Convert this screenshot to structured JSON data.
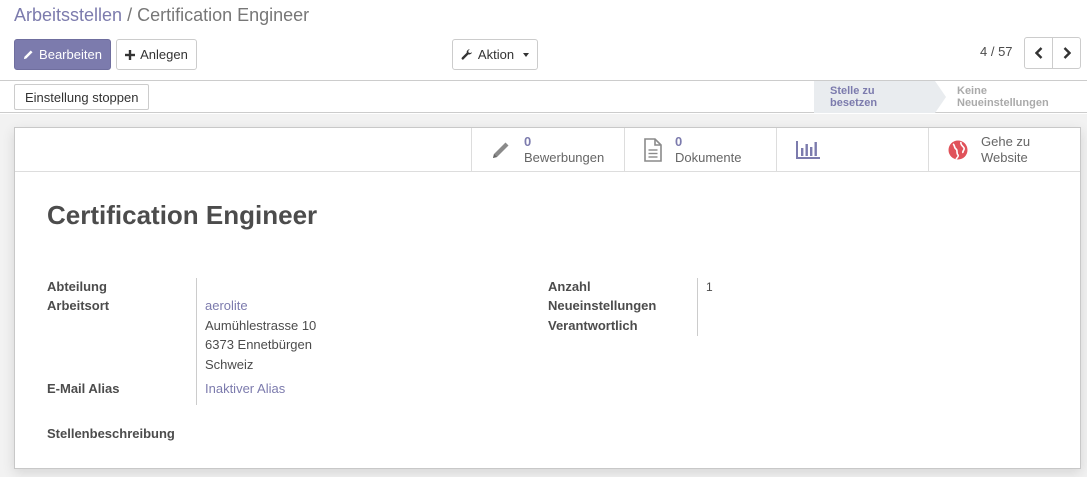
{
  "breadcrumb": {
    "parent": "Arbeitsstellen",
    "separator": "/",
    "current": "Certification Engineer"
  },
  "toolbar": {
    "edit_label": "Bearbeiten",
    "create_label": "Anlegen",
    "action_label": "Aktion"
  },
  "pager": {
    "value": "4 / 57"
  },
  "header": {
    "stop_recruiting_label": "Einstellung stoppen",
    "stages": [
      {
        "label": "Stelle zu besetzen",
        "active": true
      },
      {
        "label": "Keine Neueinstellungen",
        "active": false
      }
    ]
  },
  "smart_buttons": [
    {
      "count": "0",
      "label": "Bewerbungen",
      "icon": "pencil-icon"
    },
    {
      "count": "0",
      "label": "Dokumente",
      "icon": "document-icon"
    },
    {
      "count": "",
      "label": "",
      "icon": "bar-chart-icon"
    },
    {
      "line1": "Gehe zu",
      "line2": "Website",
      "icon": "globe-icon"
    }
  ],
  "job": {
    "title": "Certification Engineer"
  },
  "fields": {
    "department_label": "Abteilung",
    "department_value": "",
    "location_label": "Arbeitsort",
    "location_name": "aerolite",
    "address_line1": "Aumühlestrasse 10",
    "address_line2": "6373 Ennetbürgen",
    "address_line3": "Schweiz",
    "alias_label": "E-Mail Alias",
    "alias_value": "Inaktiver Alias",
    "hires_label_line1": "Anzahl",
    "hires_label_line2": "Neueinstellungen",
    "hires_value": "1",
    "responsible_label": "Verantwortlich",
    "responsible_value": "",
    "description_label": "Stellenbeschreibung"
  },
  "colors": {
    "brand": "#7c7bad",
    "globe": "#e0525a"
  }
}
